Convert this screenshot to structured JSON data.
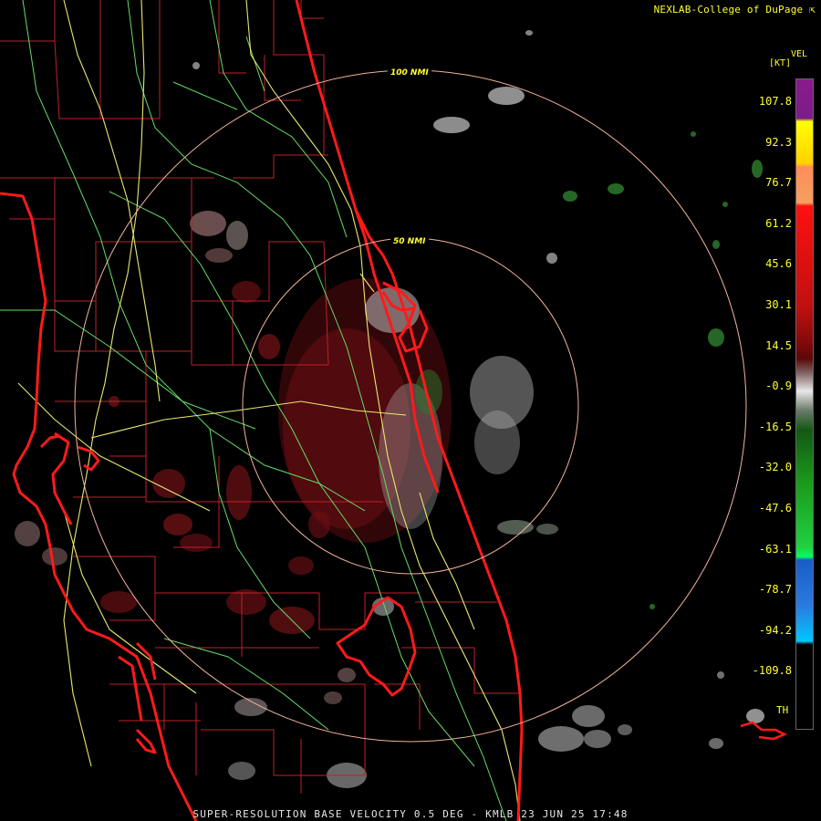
{
  "header": {
    "credit": "NEXLAB-College of DuPage"
  },
  "footer": {
    "product": "SUPER-RESOLUTION BASE VELOCITY 0.5 DEG - KMLB 23 JUN 25 17:48"
  },
  "range_rings": [
    {
      "label": "100 NMI"
    },
    {
      "label": "50 NMI"
    }
  ],
  "legend": {
    "title": "VEL",
    "unit": "[KT]",
    "ticks": [
      "107.8",
      "92.3",
      "76.7",
      "61.2",
      "45.6",
      "30.1",
      "14.5",
      "-0.9",
      "-16.5",
      "-32.0",
      "-47.6",
      "-63.1",
      "-78.7",
      "-94.2",
      "-109.8"
    ],
    "th_label": "TH"
  },
  "colors": {
    "background": "#000000",
    "text": "#ffff33",
    "coastline": "#ff1a1a",
    "county_lines": "#c0202a",
    "highways": "#e8e870",
    "secondary_roads": "#66dd66",
    "range_ring": "#f2b49a"
  }
}
